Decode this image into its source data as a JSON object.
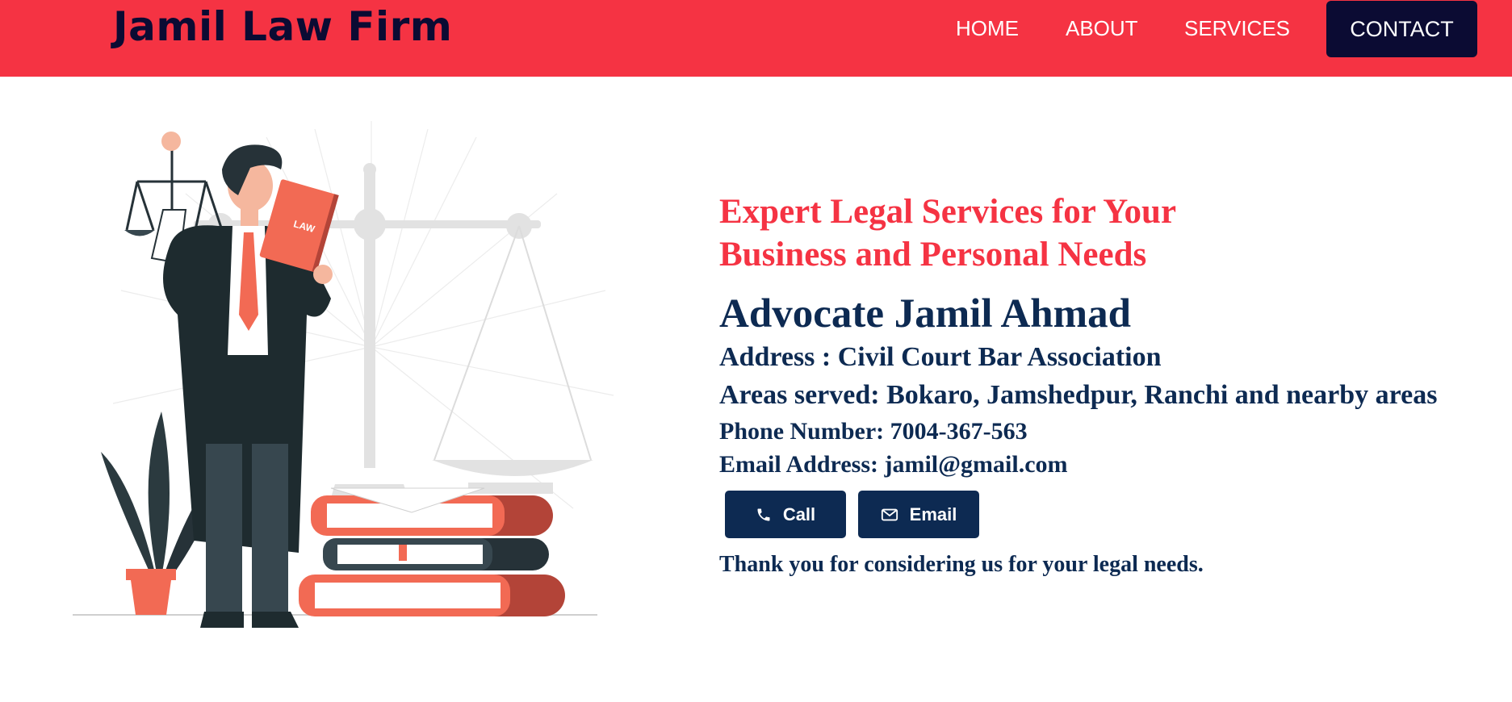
{
  "navbar": {
    "brand": "Jamil Law Firm",
    "links": [
      {
        "label": "HOME"
      },
      {
        "label": "ABOUT"
      },
      {
        "label": "SERVICES"
      },
      {
        "label": "CONTACT"
      }
    ],
    "background_color": "#f53343",
    "cta_color": "#0b0b33"
  },
  "hero": {
    "tagline_line1": "Expert Legal Services for Your",
    "tagline_line2": "Business and Personal Needs",
    "name": "Advocate Jamil Ahmad",
    "address": "Address : Civil Court Bar Association",
    "areas": "Areas served: Bokaro, Jamshedpur, Ranchi and nearby areas",
    "phone": "Phone Number: 7004-367-563",
    "email": "Email Address: jamil@gmail.com",
    "buttons": {
      "call_label": "Call",
      "call_icon": "phone-icon",
      "email_label": "Email",
      "email_icon": "envelope-icon"
    },
    "thanks": "Thank you for considering us for your legal needs.",
    "text_color": "#0d2a52",
    "accent_color": "#f53343"
  },
  "illustration": {
    "book_label": "LAW",
    "description_icon": "lawyer-with-scales-illustration"
  }
}
